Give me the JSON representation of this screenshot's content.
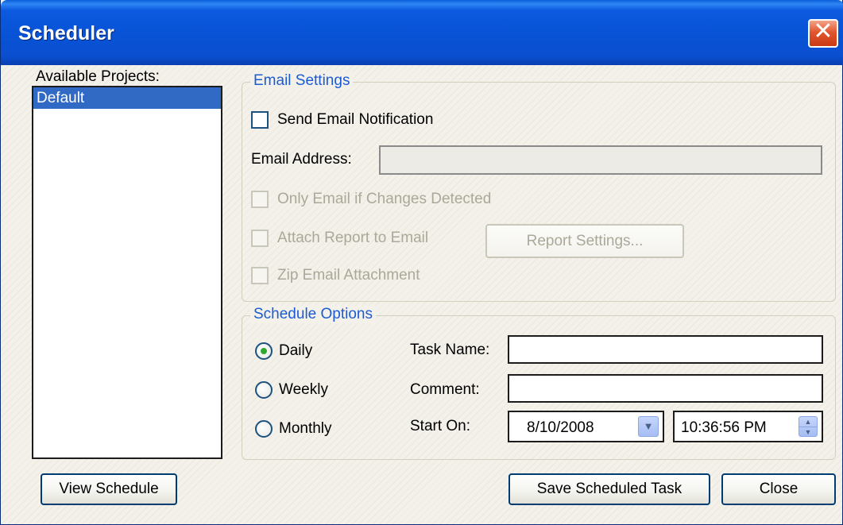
{
  "window": {
    "title": "Scheduler"
  },
  "projects": {
    "label": "Available Projects:",
    "items": [
      {
        "label": "Default",
        "selected": true
      }
    ]
  },
  "email_settings": {
    "group_title": "Email Settings",
    "send_notification": {
      "label": "Send Email Notification",
      "checked": false
    },
    "email_address": {
      "label": "Email Address:",
      "value": ""
    },
    "only_changes": {
      "label": "Only Email if Changes Detected",
      "checked": false
    },
    "attach_report": {
      "label": "Attach Report to Email",
      "checked": false
    },
    "report_settings_button": "Report Settings...",
    "zip_attachment": {
      "label": "Zip Email Attachment",
      "checked": false
    }
  },
  "schedule_options": {
    "group_title": "Schedule Options",
    "frequency": {
      "daily": "Daily",
      "weekly": "Weekly",
      "monthly": "Monthly",
      "selected": "Daily"
    },
    "task_name": {
      "label": "Task Name:",
      "value": ""
    },
    "comment": {
      "label": "Comment:",
      "value": ""
    },
    "start_on": {
      "label": "Start On:",
      "date": "8/10/2008",
      "time": "10:36:56 PM"
    }
  },
  "buttons": {
    "view_schedule": "View Schedule",
    "save_task": "Save Scheduled Task",
    "close": "Close"
  },
  "colors": {
    "titlebar": "#0853d6",
    "selection": "#316ac5",
    "group_title": "#1c5bd3",
    "radio_dot": "#2fa82f"
  }
}
